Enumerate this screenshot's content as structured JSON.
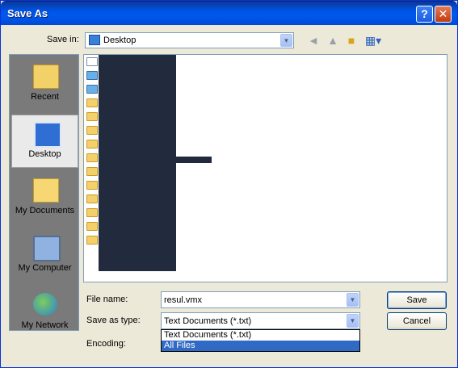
{
  "window": {
    "title": "Save As"
  },
  "titlebar": {
    "help": "?",
    "close": "✕"
  },
  "toolbar": {
    "save_in_label": "Save in:",
    "save_in_value": "Desktop",
    "back_icon": "back-arrow-icon",
    "up_icon": "up-one-level-icon",
    "new_folder_icon": "new-folder-icon",
    "views_icon": "views-menu-icon"
  },
  "places": [
    {
      "label": "Recent",
      "icon": "recent-folder-icon",
      "selected": false
    },
    {
      "label": "Desktop",
      "icon": "desktop-icon",
      "selected": true
    },
    {
      "label": "My Documents",
      "icon": "my-documents-icon",
      "selected": false
    },
    {
      "label": "My Computer",
      "icon": "my-computer-icon",
      "selected": false
    },
    {
      "label": "My Network",
      "icon": "my-network-icon",
      "selected": false
    }
  ],
  "file_list": {
    "item_icons": [
      "document-icon",
      "network-icon",
      "network-icon",
      "folder-icon",
      "folder-icon",
      "folder-icon",
      "folder-icon",
      "folder-icon",
      "folder-icon",
      "folder-icon",
      "folder-icon",
      "folder-icon",
      "folder-icon",
      "folder-icon"
    ]
  },
  "form": {
    "file_name_label": "File name:",
    "file_name_value": "resul.vmx",
    "save_as_type_label": "Save as type:",
    "save_as_type_value": "Text Documents (*.txt)",
    "encoding_label": "Encoding:",
    "type_options": [
      {
        "label": "Text Documents (*.txt)",
        "selected": false
      },
      {
        "label": "All Files",
        "selected": true
      }
    ]
  },
  "buttons": {
    "save": "Save",
    "cancel": "Cancel"
  },
  "colors": {
    "titlebar": "#0054e3",
    "selection": "#316ac5",
    "redaction": "#222a3d"
  }
}
